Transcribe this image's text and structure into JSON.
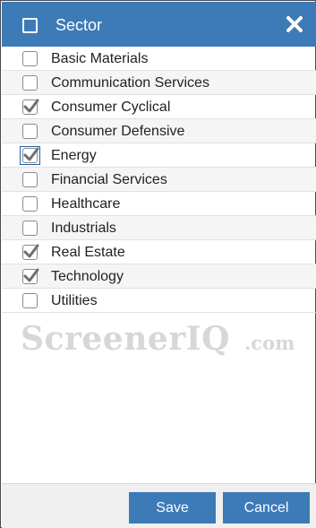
{
  "header": {
    "title": "Sector",
    "select_all_checked": false,
    "close_icon": "close-icon"
  },
  "sectors": [
    {
      "label": "Basic Materials",
      "checked": false
    },
    {
      "label": "Communication Services",
      "checked": false
    },
    {
      "label": "Consumer Cyclical",
      "checked": true
    },
    {
      "label": "Consumer Defensive",
      "checked": false
    },
    {
      "label": "Energy",
      "checked": true,
      "focused": true
    },
    {
      "label": "Financial Services",
      "checked": false
    },
    {
      "label": "Healthcare",
      "checked": false
    },
    {
      "label": "Industrials",
      "checked": false
    },
    {
      "label": "Real Estate",
      "checked": true
    },
    {
      "label": "Technology",
      "checked": true
    },
    {
      "label": "Utilities",
      "checked": false
    }
  ],
  "watermark": {
    "main": "ScreenerIQ",
    "sub": ".com"
  },
  "footer": {
    "save_label": "Save",
    "cancel_label": "Cancel"
  },
  "colors": {
    "header_bg": "#3d7ab8",
    "button_bg": "#3d7ab8",
    "check_color": "#6e6e6e"
  }
}
